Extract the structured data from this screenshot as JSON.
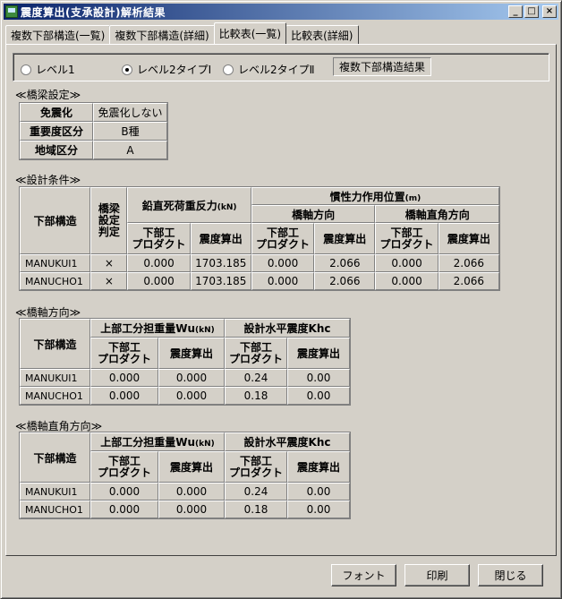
{
  "window": {
    "title": "震度算出(支承設計)解析結果"
  },
  "tabs": [
    "複数下部構造(一覧)",
    "複数下部構造(詳細)",
    "比較表(一覧)",
    "比較表(詳細)"
  ],
  "levels": {
    "options": [
      "レベル1",
      "レベル2タイプⅠ",
      "レベル2タイプⅡ"
    ],
    "selected": "レベル2タイプⅠ",
    "mode_label": "複数下部構造結果"
  },
  "bridge_settings": {
    "title": "≪橋梁設定≫",
    "rows": [
      {
        "label": "免震化",
        "value": "免震化しない"
      },
      {
        "label": "重要度区分",
        "value": "B種"
      },
      {
        "label": "地域区分",
        "value": "A"
      }
    ]
  },
  "design_conditions": {
    "title": "≪設計条件≫",
    "headers": {
      "substructure": "下部構造",
      "bridge_judge": [
        "橋梁",
        "設定",
        "判定"
      ],
      "vertical_reaction": "鉛直死荷重反力",
      "vertical_unit": "(kN)",
      "inertia_position": "慣性力作用位置",
      "inertia_unit": "(m)",
      "bridge_axis": "橋軸方向",
      "perpendicular": "橋軸直角方向",
      "product": [
        "下部工",
        "プロダクト"
      ],
      "seismic_calc": "震度算出"
    },
    "rows": [
      {
        "name": "MANUKUI1",
        "judge": "×",
        "v_product": "0.000",
        "v_calc": "1703.185",
        "ax_product": "0.000",
        "ax_calc": "2.066",
        "perp_product": "0.000",
        "perp_calc": "2.066"
      },
      {
        "name": "MANUCHO1",
        "judge": "×",
        "v_product": "0.000",
        "v_calc": "1703.185",
        "ax_product": "0.000",
        "ax_calc": "2.066",
        "perp_product": "0.000",
        "perp_calc": "2.066"
      }
    ]
  },
  "axis_direction": {
    "title": "≪橋軸方向≫",
    "headers": {
      "substructure": "下部構造",
      "weight": "上部工分担重量Wu",
      "weight_unit": "(kN)",
      "khc": "設計水平震度Khc",
      "product": [
        "下部工",
        "プロダクト"
      ],
      "seismic_calc": "震度算出"
    },
    "rows": [
      {
        "name": "MANUKUI1",
        "w_product": "0.000",
        "w_calc": "0.000",
        "k_product": "0.24",
        "k_calc": "0.00"
      },
      {
        "name": "MANUCHO1",
        "w_product": "0.000",
        "w_calc": "0.000",
        "k_product": "0.18",
        "k_calc": "0.00"
      }
    ]
  },
  "perpendicular_direction": {
    "title": "≪橋軸直角方向≫",
    "headers": {
      "substructure": "下部構造",
      "weight": "上部工分担重量Wu",
      "weight_unit": "(kN)",
      "khc": "設計水平震度Khc",
      "product": [
        "下部工",
        "プロダクト"
      ],
      "seismic_calc": "震度算出"
    },
    "rows": [
      {
        "name": "MANUKUI1",
        "w_product": "0.000",
        "w_calc": "0.000",
        "k_product": "0.24",
        "k_calc": "0.00"
      },
      {
        "name": "MANUCHO1",
        "w_product": "0.000",
        "w_calc": "0.000",
        "k_product": "0.18",
        "k_calc": "0.00"
      }
    ]
  },
  "buttons": {
    "font": "フォント",
    "print": "印刷",
    "close": "閉じる"
  }
}
